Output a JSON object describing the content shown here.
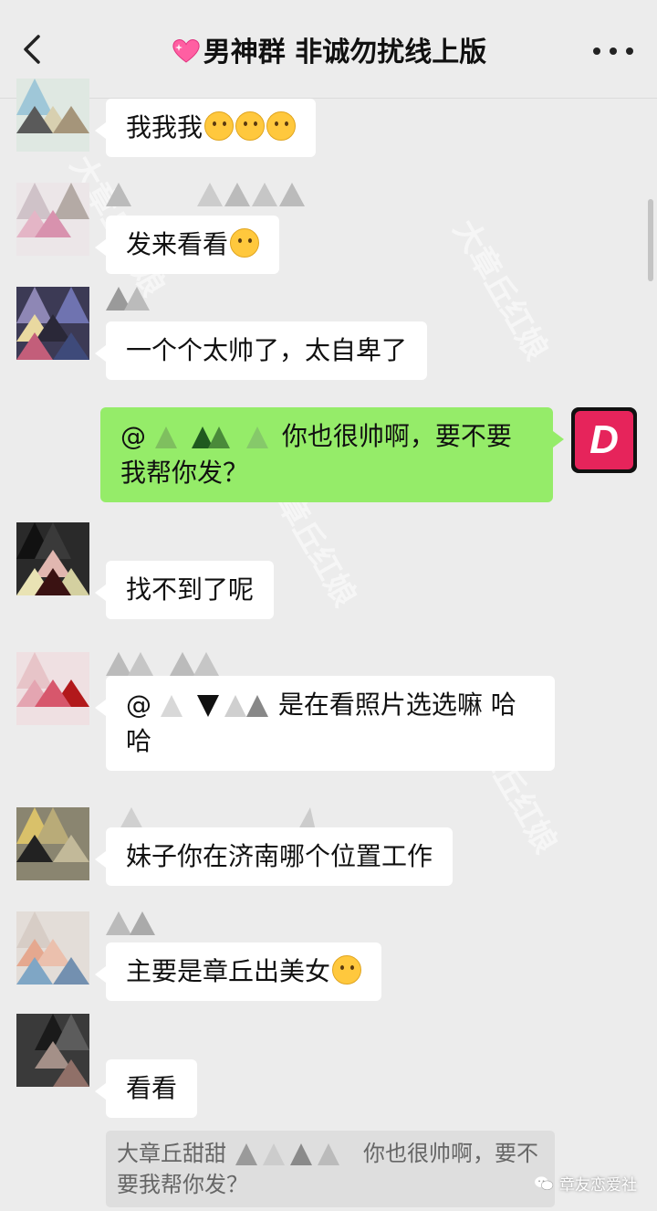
{
  "header": {
    "title": "男神群 非诚勿扰线上版",
    "back_icon": "chevron-left-icon",
    "more_icon": "more-dots-icon",
    "heart_icon": "sparkling-heart-icon"
  },
  "messages": [
    {
      "text": "我我我"
    },
    {
      "text": "发来看看"
    },
    {
      "text": "一个个太帅了，太自卑了"
    },
    {
      "prefix": "@",
      "text": "你也很帅啊，要不要我帮你发？",
      "self": true
    },
    {
      "text": "找不到了呢"
    },
    {
      "prefix": "@",
      "text": "是在看照片选选嘛 哈哈"
    },
    {
      "text": "妹子你在济南哪个位置工作"
    },
    {
      "text": "主要是章丘出美女"
    },
    {
      "text": "看看"
    }
  ],
  "quote": {
    "sender": "大章丘甜甜",
    "text": "你也很帅啊，要不要我帮你发？"
  },
  "self_avatar_letter": "D",
  "watermark_text": "大章丘红娘",
  "brand": "章友恋爱社",
  "colors": {
    "self_bubble": "#95ec69",
    "bubble": "#ffffff",
    "background": "#ececec",
    "self_avatar": "#e6245b"
  }
}
